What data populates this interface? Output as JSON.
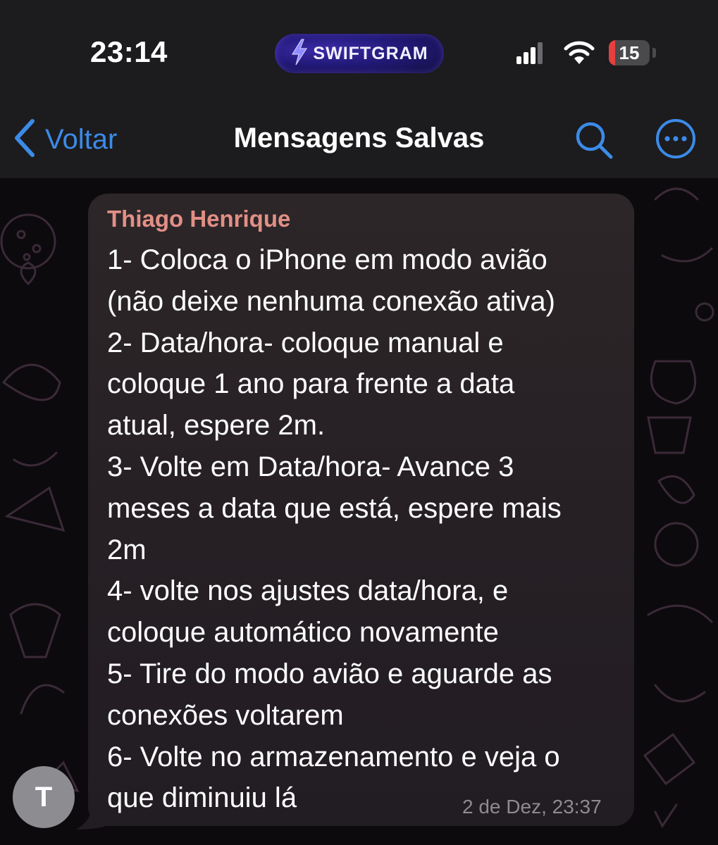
{
  "status_bar": {
    "time": "23:14",
    "app_badge": "SWIFTGRAM",
    "battery_level": "15",
    "battery_fraction": 0.15,
    "cellular_bars": 3,
    "icons": [
      "signal-icon",
      "wifi-icon",
      "battery-icon",
      "lightning-icon"
    ]
  },
  "nav": {
    "back_label": "Voltar",
    "title": "Mensagens Salvas",
    "icons": [
      "chevron-left-icon",
      "search-icon",
      "more-icon"
    ]
  },
  "message": {
    "sender": "Thiago Henrique",
    "text": "1- Coloca o iPhone em modo avião\n(não deixe nenhuma conexão ativa)\n2- Data/hora- coloque manual e\ncoloque 1 ano para frente a data\natual, espere 2m.\n3- Volte em Data/hora- Avance 3\nmeses a data que está, espere mais\n2m\n4- volte nos ajustes data/hora, e\ncoloque automático novamente\n5- Tire do modo avião e aguarde as\nconexões voltarem\n6- Volte no armazenamento e veja o\nque diminuiu lá",
    "timestamp": "2 de Dez, 23:37",
    "avatar_initial": "T"
  },
  "colors": {
    "accent": "#3b8be8",
    "sender_name": "#e28f86",
    "battery_low": "#e5403e",
    "bubble": "#262025",
    "header": "#1c1b1d"
  }
}
